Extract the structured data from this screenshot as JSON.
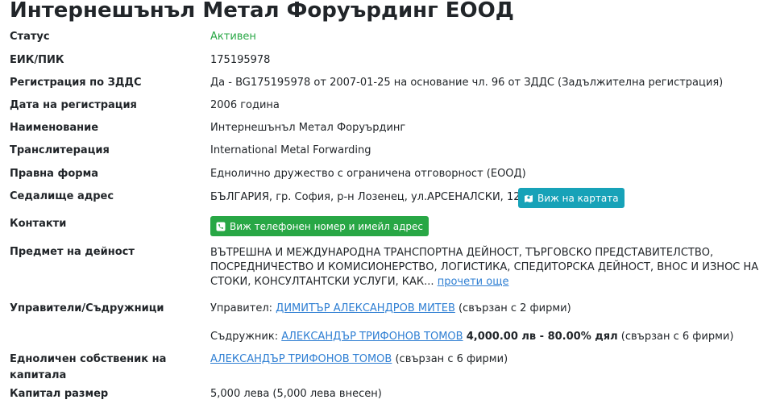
{
  "title": "Интернешънъл Метал Форуърдинг ЕООД",
  "labels": {
    "status": "Статус",
    "eik": "ЕИК/ПИК",
    "vat": "Регистрация по ЗДДС",
    "reg_date": "Дата на регистрация",
    "name": "Наименование",
    "translit": "Транслитерация",
    "legal_form": "Правна форма",
    "address": "Седалище адрес",
    "contacts": "Контакти",
    "activity": "Предмет на дейност",
    "managers": "Управители/Съдружници",
    "sole_owner_line1": "Едноличен собственик на",
    "sole_owner_line2": "капитала",
    "capital": "Капитал размер"
  },
  "values": {
    "status": "Активен",
    "eik": "175195978",
    "vat": "Да - BG175195978 от 2007-01-25 на основание чл. 96 от ЗДДС (Задължителна регистрация)",
    "reg_date": "2006 година",
    "name": "Интернешънъл Метал Форуърдинг",
    "translit": "International Metal Forwarding",
    "legal_form": "Еднолично дружество с ограничена отговорност (ЕООД)",
    "address": "БЪЛГАРИЯ, гр. София, р-н Лозенец, ул.АРСЕНАЛСКИ, 123",
    "map_button": "Виж на картата",
    "contacts_button": "Виж телефонен номер и имейл адрес",
    "activity": "ВЪТРЕШНА И МЕЖДУНАРОДНА ТРАНСПОРТНА ДЕЙНОСТ, ТЪРГОВСКО ПРЕДСТАВИТЕЛСТВО, ПОСРЕДНИЧЕСТВО И КОМИСИОНЕРСТВО, ЛОГИСТИКА, СПЕДИТОРСКА ДЕЙНОСТ, ВНОС И ИЗНОС НА СТОКИ, КОНСУЛТАНТСКИ УСЛУГИ, КАК...",
    "read_more": "прочети още",
    "manager_prefix": "Управител:",
    "manager_name": "ДИМИТЪР АЛЕКСАНДРОВ МИТЕВ",
    "manager_suffix": "(свързан с 2 фирми)",
    "partner_prefix": "Съдружник:",
    "partner_name": "АЛЕКСАНДЪР ТРИФОНОВ ТОМОВ",
    "partner_share": "4,000.00 лв - 80.00% дял",
    "partner_suffix": "(свързан с 6 фирми)",
    "owner_name": "АЛЕКСАНДЪР ТРИФОНОВ ТОМОВ",
    "owner_suffix": "(свързан с 6 фирми)",
    "capital": "5,000 лева (5,000 лева внесен)"
  },
  "colors": {
    "accent_green": "#28a745",
    "info_button": "#17a2b8",
    "link": "#2f7fd3"
  },
  "icons": {
    "map_button": "map-icon",
    "contacts_button": "phone-square-icon"
  }
}
